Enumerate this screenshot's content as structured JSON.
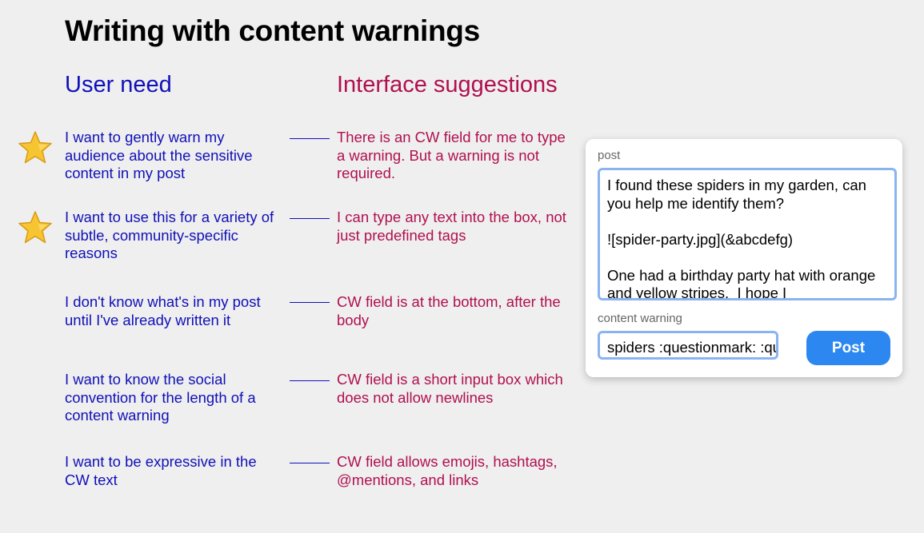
{
  "title": "Writing with content warnings",
  "columns": {
    "user_need": "User need",
    "interface_suggestions": "Interface suggestions"
  },
  "rows": [
    {
      "starred": true,
      "need": "I want to gently warn my audience about the sensitive content in my post",
      "suggestion": "There is an CW field for me to type a warning.  But a warning is not required."
    },
    {
      "starred": true,
      "need": "I want to use this for a variety of subtle, community-specific reasons",
      "suggestion": "I can type any text into the box, not just predefined tags"
    },
    {
      "starred": false,
      "need": "I don't know what's in my post until I've already written it",
      "suggestion": "CW field is at the bottom, after the body"
    },
    {
      "starred": false,
      "need": "I want to know the social convention for the length of a content warning",
      "suggestion": "CW field is a short input box which does not allow newlines"
    },
    {
      "starred": false,
      "need": "I want to be expressive in the CW text",
      "suggestion": "CW field allows emojis, hashtags, @mentions, and links"
    }
  ],
  "composer": {
    "post_label": "post",
    "post_text": "I found these spiders in my garden, can you help me identify them?\n\n![spider-party.jpg](&abcdefg)\n\nOne had a birthday party hat with orange and yellow stripes.  I hope I",
    "cw_label": "content warning",
    "cw_value": "spiders :questionmark: :question",
    "post_button": "Post"
  },
  "icons": {
    "star": "star-icon"
  },
  "colors": {
    "need_text": "#1010b8",
    "suggestion_text": "#b0104f",
    "button": "#2d87f0",
    "field_border": "#8ab4f0"
  }
}
